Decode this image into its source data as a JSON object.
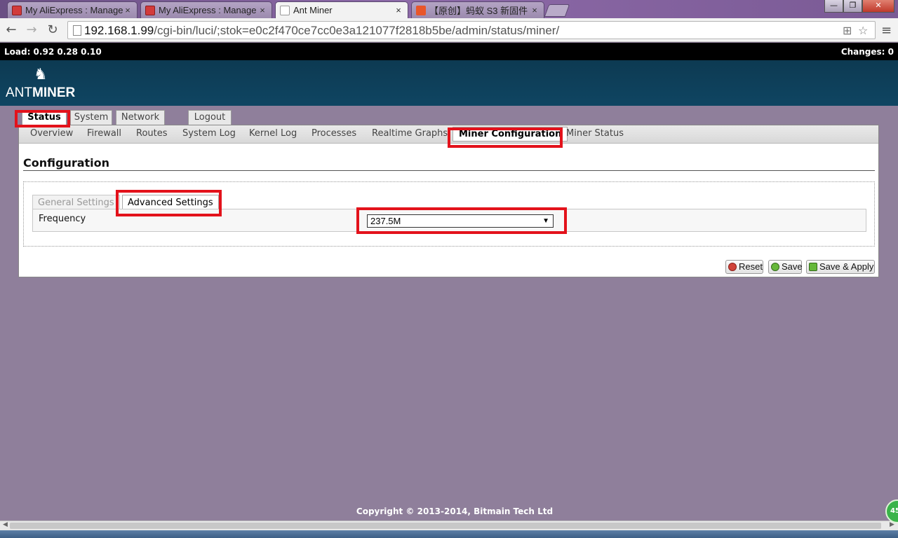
{
  "browser": {
    "tabs": [
      {
        "title": "My AliExpress : Manage",
        "favicon": "aliexpress-icon",
        "active": false
      },
      {
        "title": "My AliExpress : Manage",
        "favicon": "aliexpress-icon",
        "active": false
      },
      {
        "title": "Ant Miner",
        "favicon": "page-icon",
        "active": true
      },
      {
        "title": "【原创】蚂蚁 S3 新固件",
        "favicon": "weibo-icon",
        "active": false
      }
    ],
    "close_glyph": "×",
    "url_host": "192.168.1.99",
    "url_path": "/cgi-bin/luci/;stok=e0c2f470ce7cc0e3a121077f2818b5be/admin/status/miner/",
    "back_glyph": "←",
    "forward_glyph": "→",
    "reload_glyph": "↻",
    "star_glyph": "☆",
    "translate_glyph": "⊞",
    "menu_glyph": "≡",
    "win_min": "—",
    "win_max": "❐",
    "win_close": "✕"
  },
  "status_bar": {
    "load": "Load: 0.92 0.28 0.10",
    "changes": "Changes: 0"
  },
  "header": {
    "logo_thin": "ANT",
    "logo_bold": "MINER",
    "logo_glyph": "♞"
  },
  "top_menu": {
    "items": [
      "Status",
      "System",
      "Network",
      "Logout"
    ],
    "active": "Status"
  },
  "sub_menu": {
    "items": [
      "Overview",
      "Firewall",
      "Routes",
      "System Log",
      "Kernel Log",
      "Processes",
      "Realtime Graphs",
      "Miner Configuration",
      "Miner Status"
    ],
    "active": "Miner Configuration"
  },
  "main": {
    "title": "Configuration",
    "section_tabs": [
      "General Settings",
      "Advanced Settings"
    ],
    "active_section_tab": "Advanced Settings",
    "frequency_label": "Frequency",
    "frequency_value": "237.5M",
    "select_arrow": "▼"
  },
  "actions": {
    "reset": "Reset",
    "save": "Save",
    "save_apply": "Save & Apply"
  },
  "footer": {
    "copyright": "Copyright © 2013-2014, Bitmain Tech Ltd"
  },
  "overlay_badge": "45",
  "colors": {
    "highlight": "#e3121b",
    "header_bg": "#0f4562",
    "page_bg": "#8f7f9b"
  }
}
